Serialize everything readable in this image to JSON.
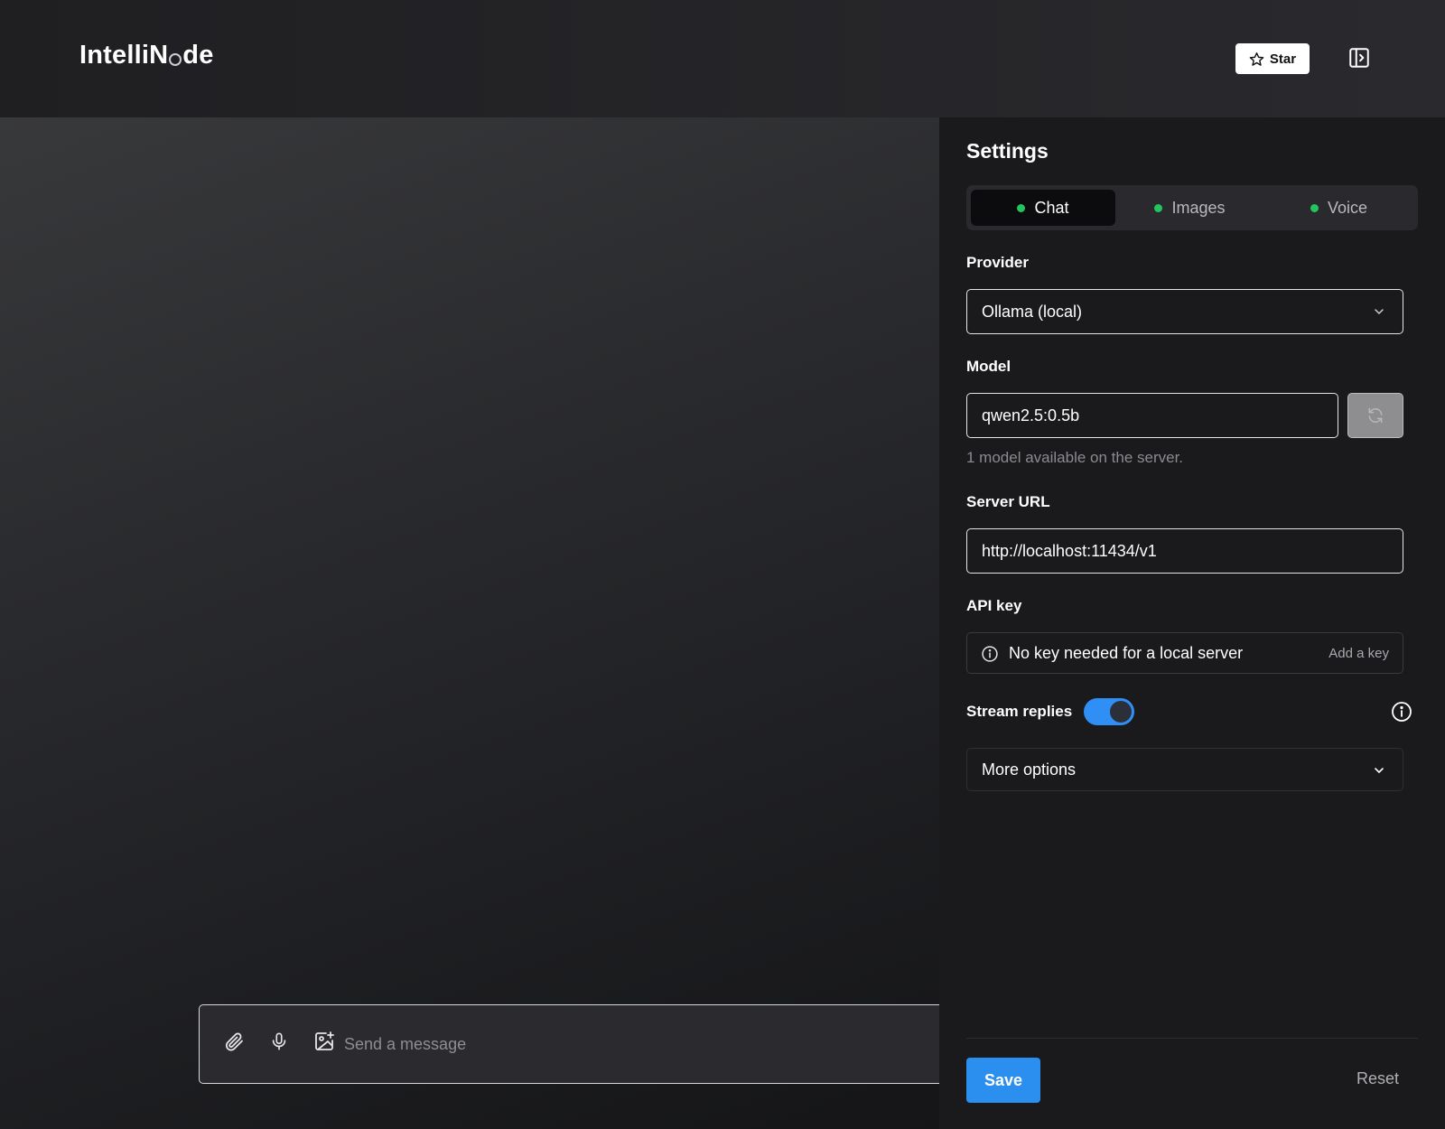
{
  "header": {
    "logo_part1": "IntelliN",
    "logo_part2": "de",
    "star_label": "Star"
  },
  "composer": {
    "placeholder": "Send a message"
  },
  "settings": {
    "title": "Settings",
    "tabs": [
      {
        "label": "Chat",
        "active": true
      },
      {
        "label": "Images",
        "active": false
      },
      {
        "label": "Voice",
        "active": false
      }
    ],
    "provider": {
      "label": "Provider",
      "value": "Ollama (local)"
    },
    "model": {
      "label": "Model",
      "value": "qwen2.5:0.5b",
      "hint": "1 model available on the server."
    },
    "server_url": {
      "label": "Server URL",
      "value": "http://localhost:11434/v1"
    },
    "api_key": {
      "label": "API key",
      "message": "No key needed for a local server",
      "add_label": "Add a key"
    },
    "stream": {
      "label": "Stream replies",
      "enabled": true
    },
    "more_options": {
      "label": "More options"
    },
    "save_label": "Save",
    "reset_label": "Reset"
  },
  "colors": {
    "accent": "#2b8ff0",
    "status_dot": "#22c55e",
    "toggle_on": "#2f8ff5"
  }
}
